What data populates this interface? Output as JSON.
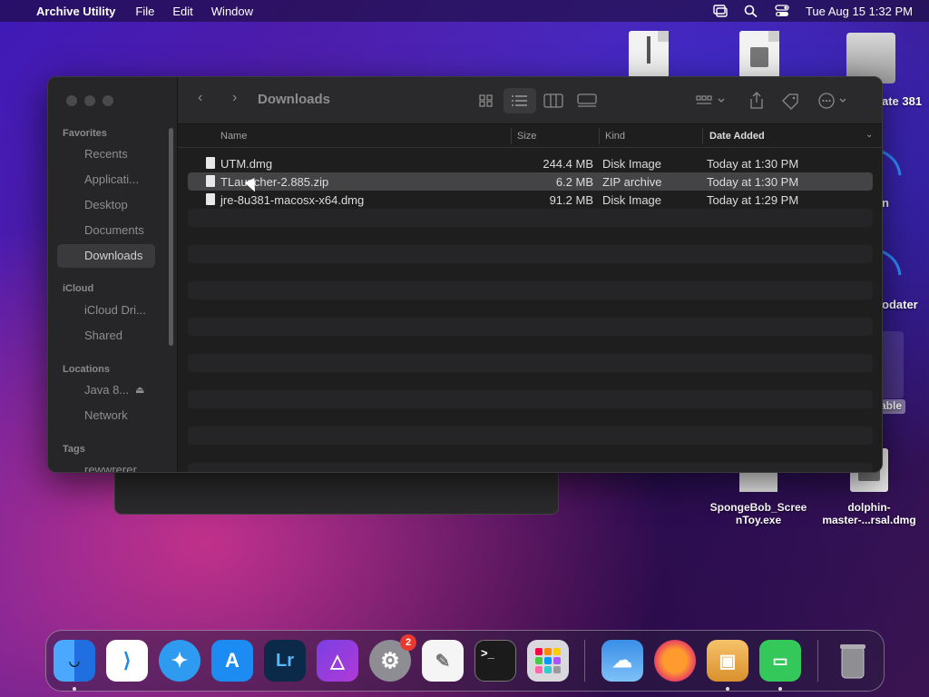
{
  "menubar": {
    "app_name": "Archive Utility",
    "menus": [
      "File",
      "Edit",
      "Window"
    ],
    "clock": "Tue Aug 15  1:32 PM",
    "icons": [
      "apple-icon",
      "screen-mirror-icon",
      "spotlight-icon",
      "control-center-icon"
    ]
  },
  "desktop": {
    "labels": [
      "ate 381",
      "n",
      "odater",
      "able",
      "SpongeBob_Scree\nnToy.exe",
      "dolphin-\nmaster-...rsal.dmg"
    ],
    "spongebob_line1": "SpongeBob_Scree",
    "spongebob_line2": "nToy.exe",
    "dolphin_line1": "dolphin-",
    "dolphin_line2": "master-...rsal.dmg",
    "partial_1": "ate 381",
    "partial_2": "n",
    "partial_3": "odater",
    "partial_4": "able"
  },
  "finder": {
    "title": "Downloads",
    "sidebar": {
      "favorites_header": "Favorites",
      "favorites": [
        "Recents",
        "Applicati...",
        "Desktop",
        "Documents",
        "Downloads"
      ],
      "icloud_header": "iCloud",
      "icloud": [
        "iCloud Dri...",
        "Shared"
      ],
      "locations_header": "Locations",
      "locations": [
        "Java 8...",
        "Network"
      ],
      "tags_header": "Tags",
      "tags": [
        "rewwrerer..."
      ]
    },
    "columns": {
      "name": "Name",
      "size": "Size",
      "kind": "Kind",
      "date": "Date Added"
    },
    "files": [
      {
        "name": "UTM.dmg",
        "size": "244.4 MB",
        "kind": "Disk Image",
        "date": "Today at 1:30 PM"
      },
      {
        "name": "TLauncher-2.885.zip",
        "size": "6.2 MB",
        "kind": "ZIP archive",
        "date": "Today at 1:30 PM"
      },
      {
        "name": "jre-8u381-macosx-x64.dmg",
        "size": "91.2 MB",
        "kind": "Disk Image",
        "date": "Today at 1:29 PM"
      }
    ]
  },
  "dock": {
    "apps": [
      "Finder",
      "Visual Studio Code",
      "Safari",
      "App Store",
      "Lightroom",
      "Affinity Photo",
      "System Settings",
      "TextEdit",
      "Terminal",
      "Launchpad",
      "Weather",
      "Firefox",
      "Archive Utility",
      "Facetime",
      "Trash"
    ],
    "lightroom_label": "Lr",
    "terminal_label": ">_",
    "settings_badge": "2"
  }
}
